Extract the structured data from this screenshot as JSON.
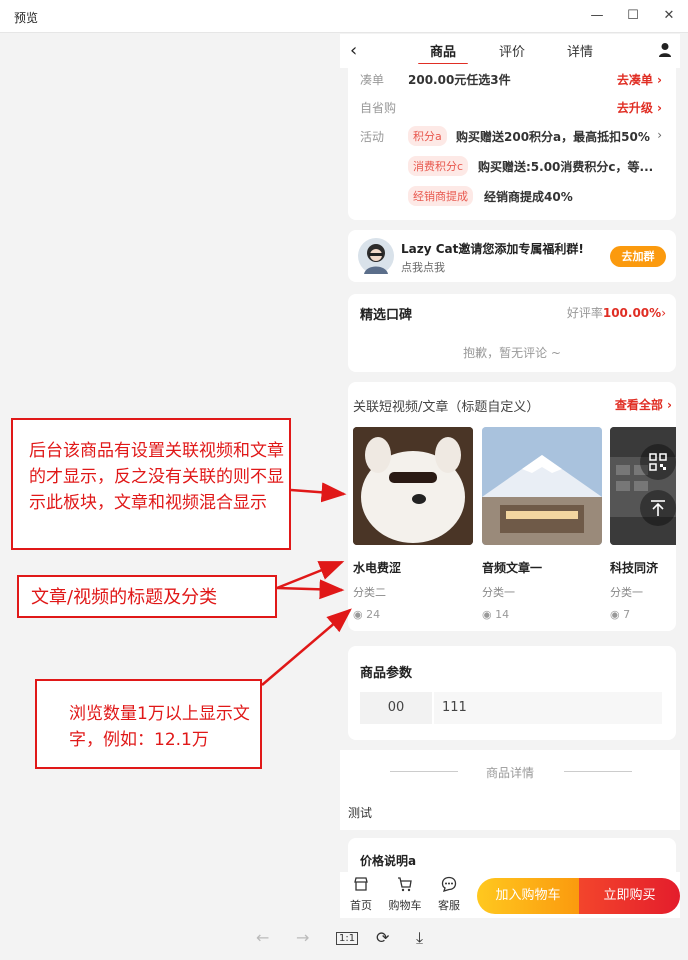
{
  "window": {
    "title": "预览"
  },
  "nav": {
    "tabs": [
      "商品",
      "评价",
      "详情"
    ]
  },
  "promo": {
    "cou_label": "凑单",
    "cou_value": "200.00元任选3件",
    "cou_link": "去凑单 ›",
    "self_label": "自省购",
    "self_link": "去升级 ›",
    "act_label": "活动",
    "tags": [
      {
        "tag": "积分a",
        "text": "购买赠送200积分a，最高抵扣50%"
      },
      {
        "tag": "消费积分c",
        "text": "购买赠送:5.00消费积分c，等..."
      },
      {
        "tag": "经销商提成",
        "text": "经销商提成40%"
      }
    ]
  },
  "group": {
    "title": "Lazy Cat邀请您添加专属福利群!",
    "sub": "点我点我",
    "button": "去加群"
  },
  "reviews": {
    "title": "精选口碑",
    "rate_label": "好评率",
    "rate_value": "100.00%",
    "empty": "抱歉，暂无评论 ~"
  },
  "media": {
    "title": "关联短视频/文章（标题自定义）",
    "view_all": "查看全部",
    "items": [
      {
        "title": "水电费涩",
        "category": "分类二",
        "views": "24"
      },
      {
        "title": "音频文章一",
        "category": "分类一",
        "views": "14"
      },
      {
        "title": "科技同济",
        "category": "分类一",
        "views": "7"
      }
    ]
  },
  "params": {
    "title": "商品参数",
    "key": "00",
    "value": "111"
  },
  "detail": {
    "divider": "商品详情",
    "text": "测试"
  },
  "price": {
    "title": "价格说明a"
  },
  "bottom": {
    "home": "首页",
    "cart": "购物车",
    "service": "客服",
    "add_cart": "加入购物车",
    "buy_now": "立即购买"
  },
  "annotations": {
    "a1": "后台该商品有设置关联视频和文章的才显示，反之没有关联的则不显示此板块，文章和视频混合显示",
    "a2": "文章/视频的标题及分类",
    "a3": "浏览数量1万以上显示文字，例如：12.1万"
  },
  "colors": {
    "accent": "#e02e24",
    "annotation": "#e01818",
    "orange": "#fb9a0e"
  }
}
